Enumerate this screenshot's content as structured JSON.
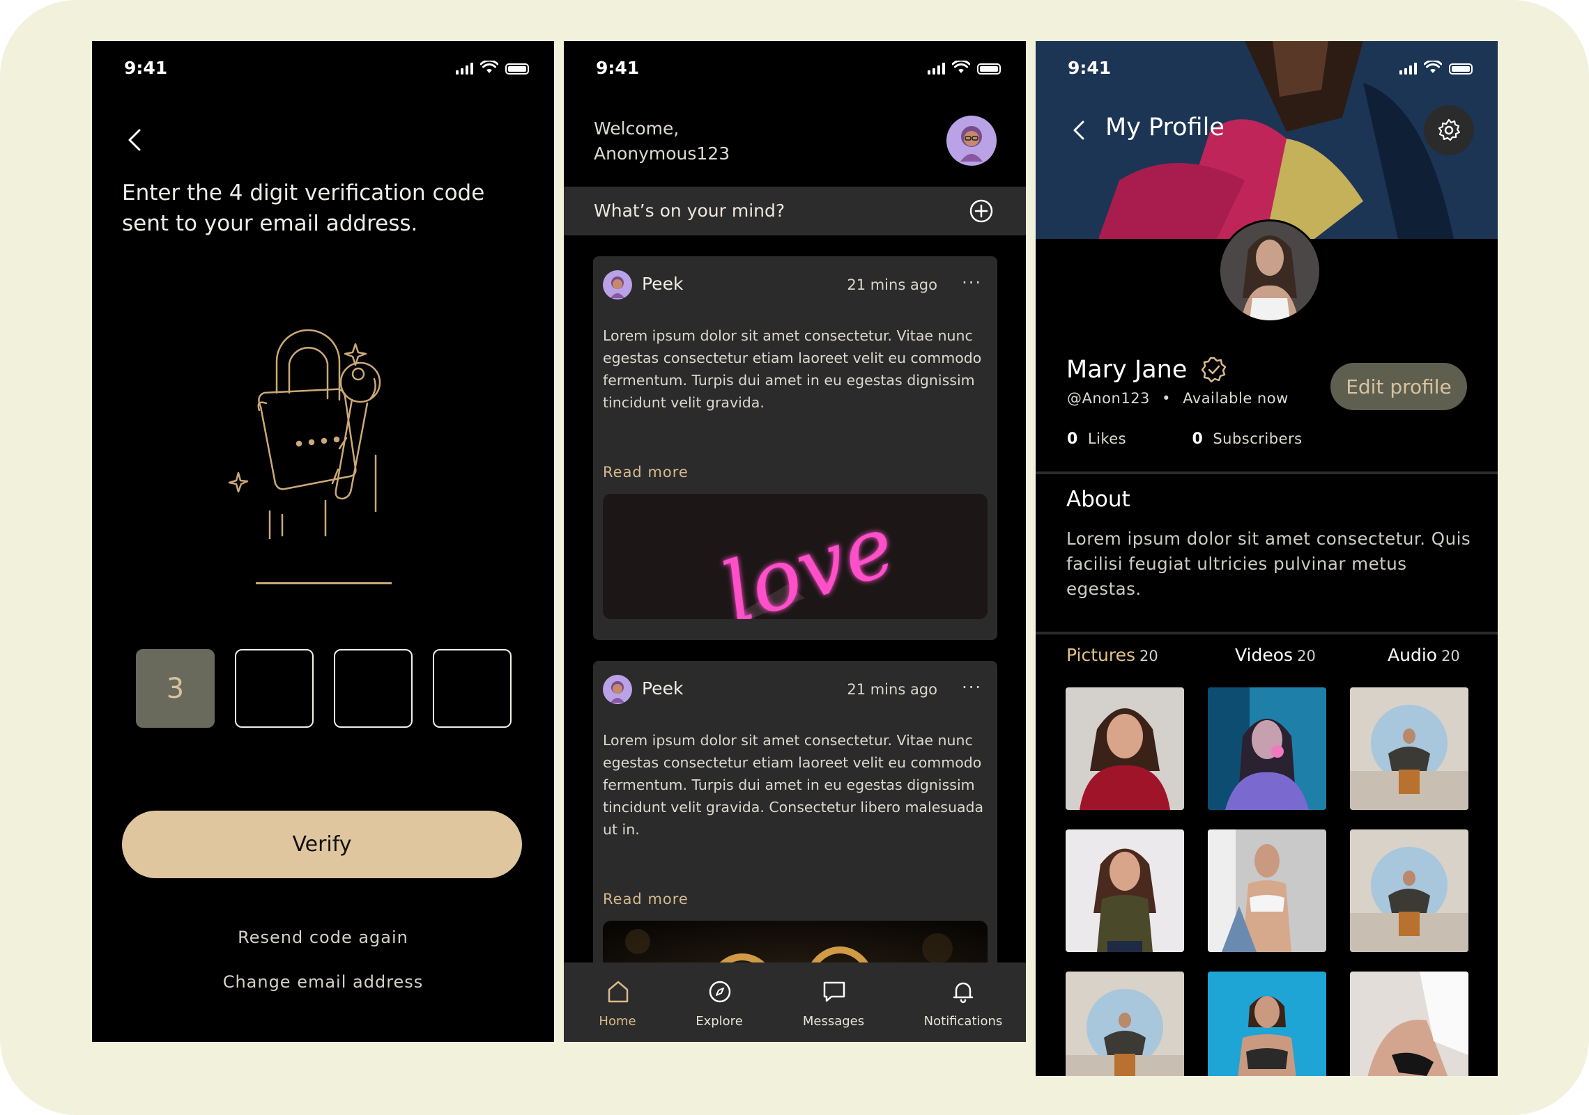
{
  "status": {
    "time": "9:41"
  },
  "verify_screen": {
    "heading_line1": "Enter the 4 digit verification code",
    "heading_line2": "sent to your email address.",
    "otp_digits": [
      "3",
      "",
      "",
      ""
    ],
    "verify_label": "Verify",
    "resend_label": "Resend code again",
    "change_email_label": "Change email address"
  },
  "feed_screen": {
    "welcome_line1": "Welcome,",
    "welcome_line2": "Anonymous123",
    "mind_prompt": "What’s on your mind?",
    "posts": [
      {
        "author": "Peek",
        "time": "21 mins ago",
        "more": "···",
        "body": "Lorem ipsum dolor sit amet consectetur. Vitae nunc egestas consectetur etiam laoreet velit eu commodo fermentum. Turpis dui amet in eu egestas dignissim tincidunt velit gravida.",
        "read_more": "Read more",
        "image_text": "love"
      },
      {
        "author": "Peek",
        "time": "21 mins ago",
        "more": "···",
        "body": "Lorem ipsum dolor sit amet consectetur. Vitae nunc egestas consectetur etiam laoreet velit eu commodo fermentum. Turpis dui amet in eu egestas dignissim tincidunt velit gravida. Consectetur libero malesuada ut in.",
        "read_more": "Read more"
      }
    ],
    "tabs": [
      {
        "label": "Home",
        "icon": "home-icon",
        "active": true
      },
      {
        "label": "Explore",
        "icon": "compass-icon",
        "active": false
      },
      {
        "label": "Messages",
        "icon": "chat-icon",
        "active": false
      },
      {
        "label": "Notifications",
        "icon": "bell-icon",
        "active": false
      }
    ]
  },
  "profile_screen": {
    "title": "My Profile",
    "name": "Mary Jane",
    "handle": "@Anon123",
    "availability": "Available now",
    "likes_count": "0",
    "likes_label": "Likes",
    "subscribers_count": "0",
    "subscribers_label": "Subscribers",
    "edit_label": "Edit profile",
    "about_title": "About",
    "about_text": "Lorem ipsum dolor sit amet consectetur. Quis facilisi feugiat ultricies pulvinar metus egestas.",
    "media_tabs": [
      {
        "label": "Pictures",
        "count": "20",
        "active": true
      },
      {
        "label": "Videos",
        "count": "20",
        "active": false
      },
      {
        "label": "Audio",
        "count": "20",
        "active": false
      }
    ]
  },
  "colors": {
    "accent": "#dfc69e",
    "accent_text": "#d4b98f",
    "card_bg": "#2b2b2b",
    "page_bg": "#f2f1dc"
  }
}
